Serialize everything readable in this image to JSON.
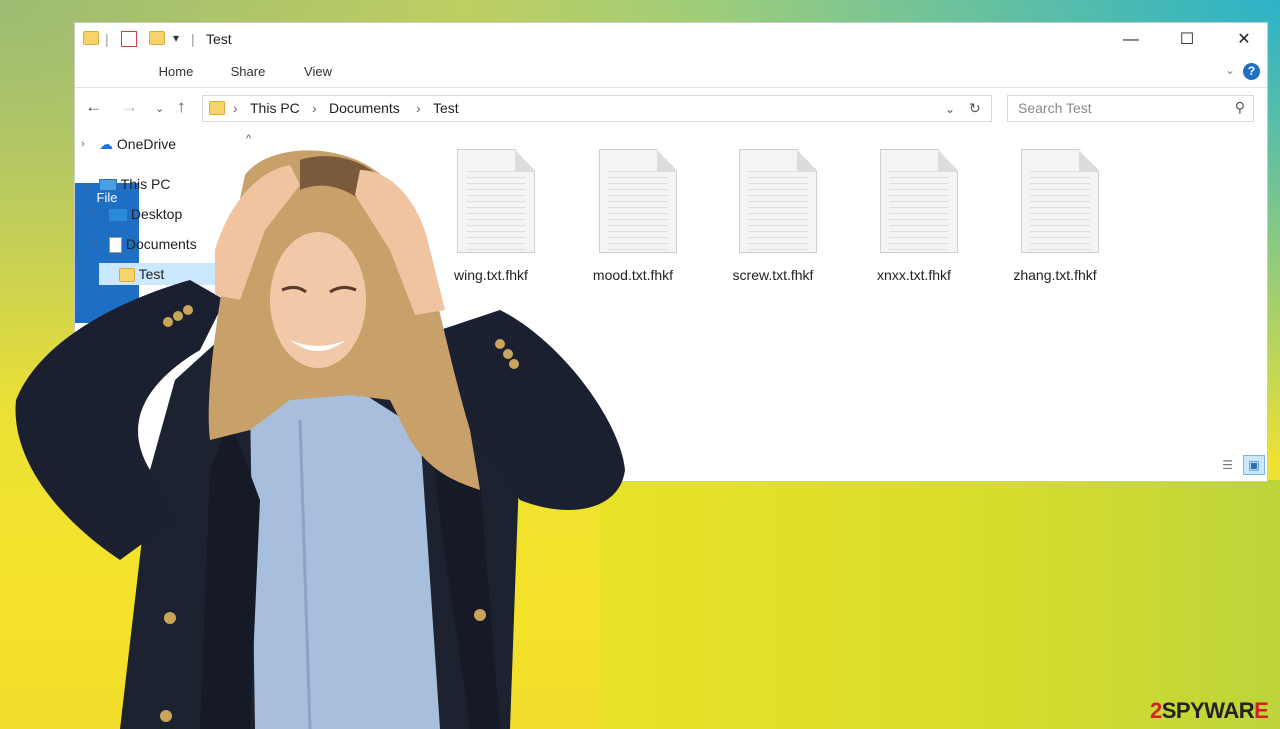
{
  "window": {
    "title": "Test",
    "controls": {
      "minimize": "—",
      "maximize": "☐",
      "close": "✕"
    }
  },
  "ribbon": {
    "tabs": [
      "File",
      "Home",
      "Share",
      "View"
    ]
  },
  "address": {
    "crumbs": [
      "This PC",
      "Documents",
      "Test"
    ]
  },
  "search": {
    "placeholder": "Search Test"
  },
  "sidebar": {
    "items": [
      {
        "label": "OneDrive",
        "icon": "cloud-icon"
      },
      {
        "label": "This PC",
        "icon": "computer-icon"
      },
      {
        "label": "Desktop",
        "icon": "desktop-icon"
      },
      {
        "label": "Documents",
        "icon": "document-icon"
      },
      {
        "label": "Test",
        "icon": "folder-icon"
      }
    ]
  },
  "files": [
    {
      "name": "wing.txt.fhkf"
    },
    {
      "name": "mood.txt.fhkf"
    },
    {
      "name": "screw.txt.fhkf"
    },
    {
      "name": "xnxx.txt.fhkf"
    },
    {
      "name": "zhang.txt.fhkf"
    }
  ],
  "brand": {
    "prefix": "2",
    "middle": "SPYWAR",
    "suffix": "E"
  },
  "colors": {
    "file_tab": "#1e6fc4",
    "selected_item": "#cce8ff",
    "brand_red": "#d32026"
  }
}
